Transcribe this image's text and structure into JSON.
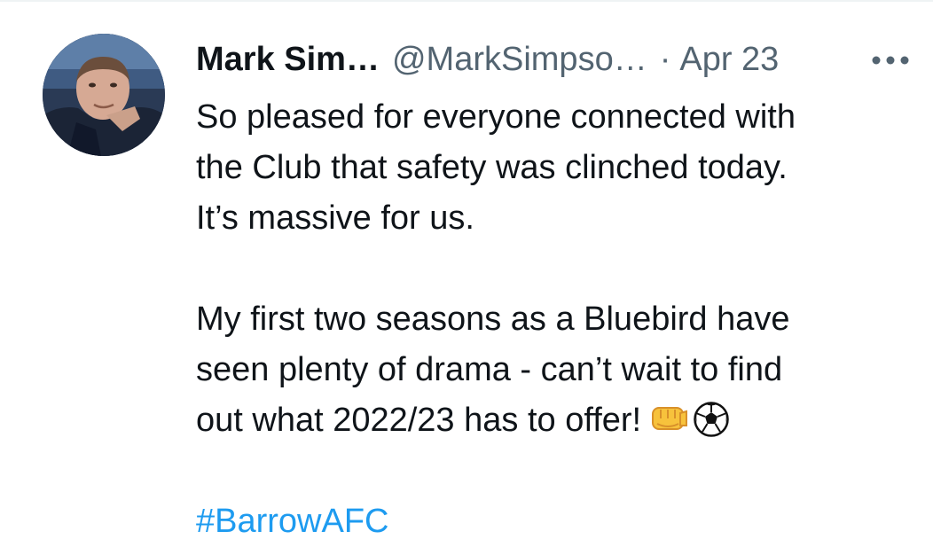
{
  "tweet": {
    "author": {
      "display_name": "Mark Sim…",
      "handle": "@MarkSimpso…",
      "avatar_icon": "profile-photo"
    },
    "separator": "·",
    "date": "Apr 23",
    "more_icon": "more-horizontal-icon",
    "text": {
      "paragraph1": [
        "So pleased for everyone connected with",
        "the Club that safety was clinched today.",
        "It’s massive for us."
      ],
      "paragraph2": [
        "My first two seasons as a Bluebird have",
        "seen plenty of drama - can’t wait to find",
        "out what 2022/23 has to offer!"
      ],
      "emojis": [
        "oncoming-fist-icon",
        "soccer-ball-icon"
      ],
      "hashtag": "#BarrowAFC"
    },
    "colors": {
      "text": "#0f1419",
      "secondary": "#536471",
      "link": "#1d9bf0"
    }
  }
}
